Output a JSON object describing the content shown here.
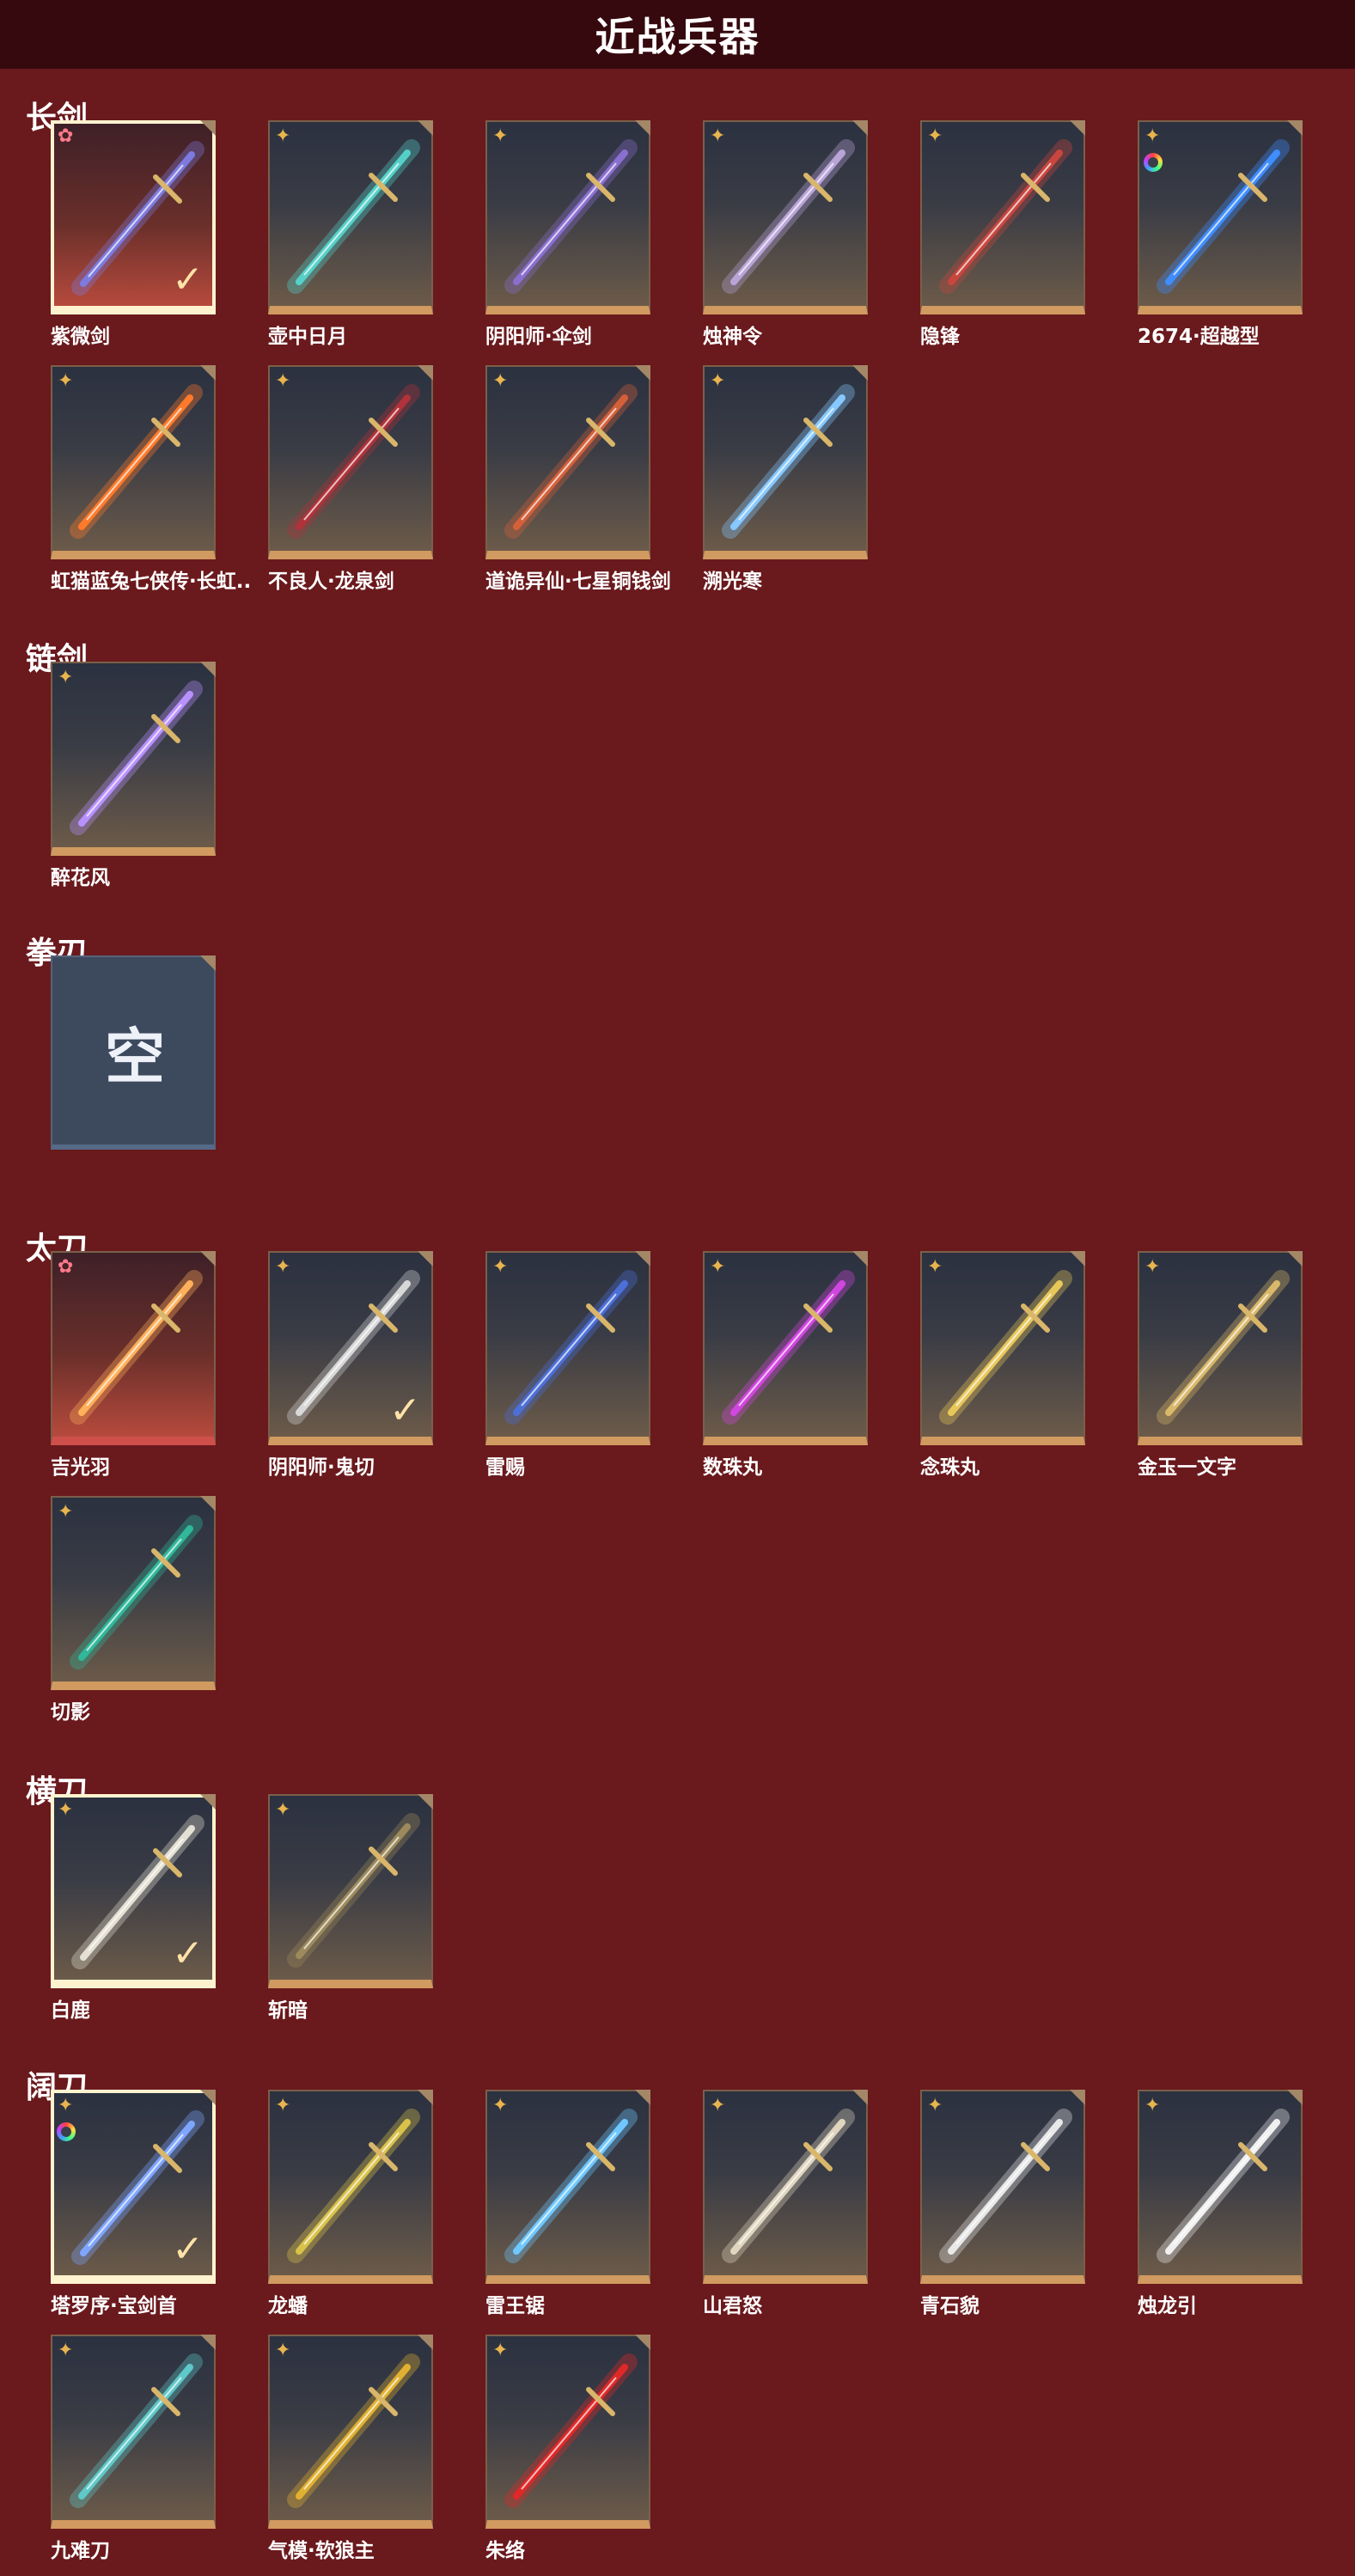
{
  "page_title": "近战兵器",
  "colors": {
    "background": "#6a191d",
    "header": "#35090e",
    "frame_accent": "#d19a60",
    "selected_border": "#fff3cf"
  },
  "sections": [
    {
      "title": "长剑",
      "items": [
        {
          "name": "紫微剑",
          "badge": "✿",
          "rarity": "red",
          "selected": true,
          "tint": "#7d7be0"
        },
        {
          "name": "壶中日月",
          "badge": "✦",
          "tint": "#55d0c8"
        },
        {
          "name": "阴阳师·伞剑",
          "badge": "✦",
          "tint": "#8a6fd0"
        },
        {
          "name": "烛神令",
          "badge": "✦",
          "tint": "#b9a4d8"
        },
        {
          "name": "隐锋",
          "badge": "✦",
          "tint": "#c9463e"
        },
        {
          "name": "2674·超越型",
          "badge": "✦",
          "ring": true,
          "tint": "#3f8dff"
        },
        {
          "name": "虹猫蓝兔七侠传·长虹..",
          "badge": "✦",
          "tint": "#ff7a2a"
        },
        {
          "name": "不良人·龙泉剑",
          "badge": "✦",
          "tint": "#b0323a"
        },
        {
          "name": "道诡异仙·七星铜钱剑",
          "badge": "✦",
          "tint": "#d4603a"
        },
        {
          "name": "溯光寒",
          "badge": "✦",
          "tint": "#86c8ff"
        }
      ]
    },
    {
      "title": "链剑",
      "items": [
        {
          "name": "醉花风",
          "badge": "✦",
          "tint": "#b891ff"
        }
      ]
    },
    {
      "title": "拳刃",
      "items": [
        {
          "name": "",
          "empty": true,
          "glyph": "空"
        }
      ]
    },
    {
      "title": "太刀",
      "items": [
        {
          "name": "吉光羽",
          "badge": "✿",
          "rarity": "red",
          "tint": "#ffb05a"
        },
        {
          "name": "阴阳师·鬼切",
          "badge": "✦",
          "selected_check": true,
          "tint": "#d8d8d8"
        },
        {
          "name": "雷赐",
          "badge": "✦",
          "tint": "#4c6fd8"
        },
        {
          "name": "数珠丸",
          "badge": "✦",
          "tint": "#d246e0"
        },
        {
          "name": "念珠丸",
          "badge": "✦",
          "tint": "#e8c75a"
        },
        {
          "name": "金玉一文字",
          "badge": "✦",
          "tint": "#d9b86a"
        },
        {
          "name": "切影",
          "badge": "✦",
          "tint": "#2fb89a"
        }
      ]
    },
    {
      "title": "横刀",
      "items": [
        {
          "name": "白鹿",
          "badge": "✦",
          "selected": true,
          "tint": "#e4e0d4"
        },
        {
          "name": "斩暗",
          "badge": "✦",
          "tint": "#9c8a5c"
        }
      ]
    },
    {
      "title": "阔刀",
      "items": [
        {
          "name": "塔罗序·宝剑首",
          "badge": "✦",
          "ring": true,
          "selected": true,
          "tint": "#7fa6ff"
        },
        {
          "name": "龙蟠",
          "badge": "✦",
          "tint": "#d9c24a"
        },
        {
          "name": "雷王锯",
          "badge": "✦",
          "tint": "#6fc8ff"
        },
        {
          "name": "山君怒",
          "badge": "✦",
          "tint": "#e0d6c0"
        },
        {
          "name": "青石貌",
          "badge": "✦",
          "tint": "#e8e8e8"
        },
        {
          "name": "烛龙引",
          "badge": "✦",
          "tint": "#f0f0f0"
        },
        {
          "name": "九难刀",
          "badge": "✦",
          "tint": "#5fc8c8"
        },
        {
          "name": "气模·软狼主",
          "badge": "✦",
          "tint": "#e0b030"
        },
        {
          "name": "朱络",
          "badge": "✦",
          "tint": "#e02828"
        }
      ]
    }
  ]
}
